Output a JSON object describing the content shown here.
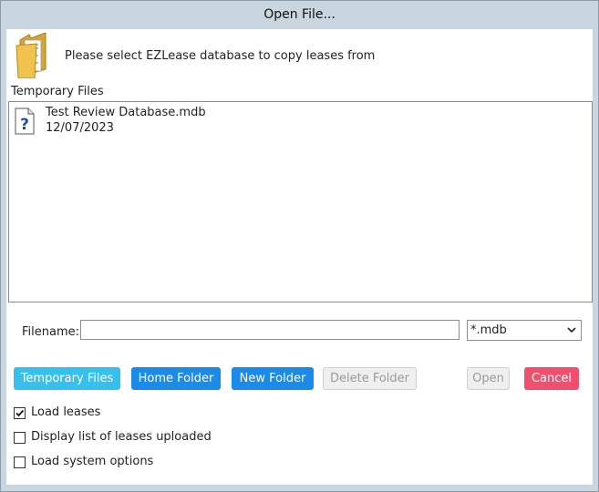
{
  "window": {
    "title": "Open File..."
  },
  "header": {
    "prompt": "Please select EZLease database to copy leases from",
    "icon": "folder-icon"
  },
  "location": {
    "label": "Temporary Files"
  },
  "files": [
    {
      "name": "Test Review Database.mdb",
      "date": "12/07/2023",
      "icon": "unknown-file-icon"
    }
  ],
  "filename": {
    "label": "Filename:",
    "value": "",
    "placeholder": ""
  },
  "filter": {
    "selected": "*.mdb"
  },
  "buttons": {
    "temporary_files": "Temporary Files",
    "home_folder": "Home Folder",
    "new_folder": "New Folder",
    "delete_folder": "Delete Folder",
    "open": "Open",
    "cancel": "Cancel"
  },
  "options": [
    {
      "label": "Load leases",
      "checked": true
    },
    {
      "label": "Display list of leases uploaded",
      "checked": false
    },
    {
      "label": "Load system options",
      "checked": false
    }
  ],
  "colors": {
    "window_frame": "#c9d6df",
    "primary_button": "#1b8bea",
    "active_button": "#35c0ee",
    "cancel_button": "#f0506e",
    "disabled_button": "#efefef"
  }
}
